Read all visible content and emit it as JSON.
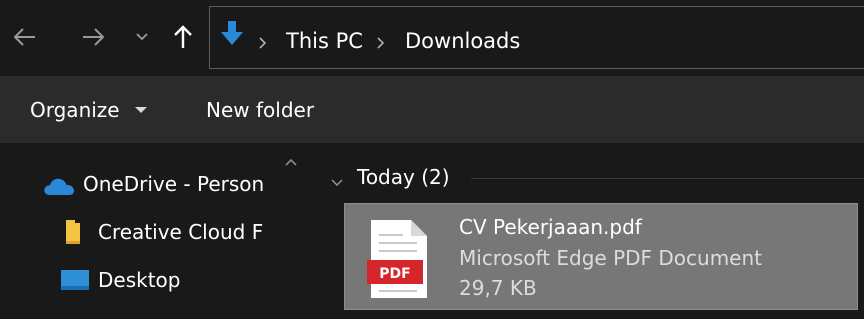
{
  "address_bar": {
    "breadcrumbs": [
      "This PC",
      "Downloads"
    ]
  },
  "command_bar": {
    "organize_label": "Organize",
    "new_folder_label": "New folder"
  },
  "navigation_pane": {
    "items": [
      {
        "label": "OneDrive - Person",
        "icon": "onedrive-cloud-icon"
      },
      {
        "label": "Creative Cloud F",
        "icon": "folder-icon"
      },
      {
        "label": "Desktop",
        "icon": "desktop-icon"
      }
    ]
  },
  "content": {
    "group": {
      "label": "Today (2)"
    },
    "files": [
      {
        "name": "CV Pekerjaaan.pdf",
        "type": "Microsoft Edge PDF Document",
        "size": "29,7 KB",
        "icon_badge": "PDF",
        "selected": true
      }
    ]
  },
  "colors": {
    "window_bg": "#191919",
    "command_bar_bg": "#2b2b2b",
    "selection_bg": "#777777",
    "accent_blue": "#2b88d8",
    "pdf_red": "#d4262b",
    "folder_yellow": "#f5c342"
  }
}
